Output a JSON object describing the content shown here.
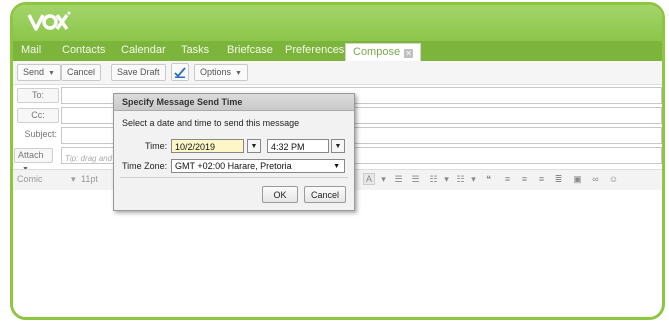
{
  "tabs": [
    {
      "label": "Mail"
    },
    {
      "label": "Contacts"
    },
    {
      "label": "Calendar"
    },
    {
      "label": "Tasks"
    },
    {
      "label": "Briefcase"
    },
    {
      "label": "Preferences"
    },
    {
      "label": "Compose"
    }
  ],
  "toolbar": {
    "send": "Send",
    "cancel": "Cancel",
    "save_draft": "Save Draft",
    "options": "Options"
  },
  "fields": {
    "to": "To:",
    "cc": "Cc:",
    "subject": "Subject:",
    "attach": "Attach",
    "attach_tip": "Tip: drag and"
  },
  "format": {
    "font": "Comic",
    "size": "11pt"
  },
  "dialog": {
    "title": "Specify Message Send Time",
    "prompt": "Select a date and time to send this message",
    "time_label": "Time:",
    "date_value": "10/2/2019",
    "time_value": "4:32 PM",
    "zone_label": "Time Zone:",
    "zone_value": "GMT +02:00 Harare, Pretoria",
    "ok": "OK",
    "cancel": "Cancel"
  },
  "colors": {
    "brand_green": "#8dc63f",
    "tab_bar": "#7db43c"
  }
}
